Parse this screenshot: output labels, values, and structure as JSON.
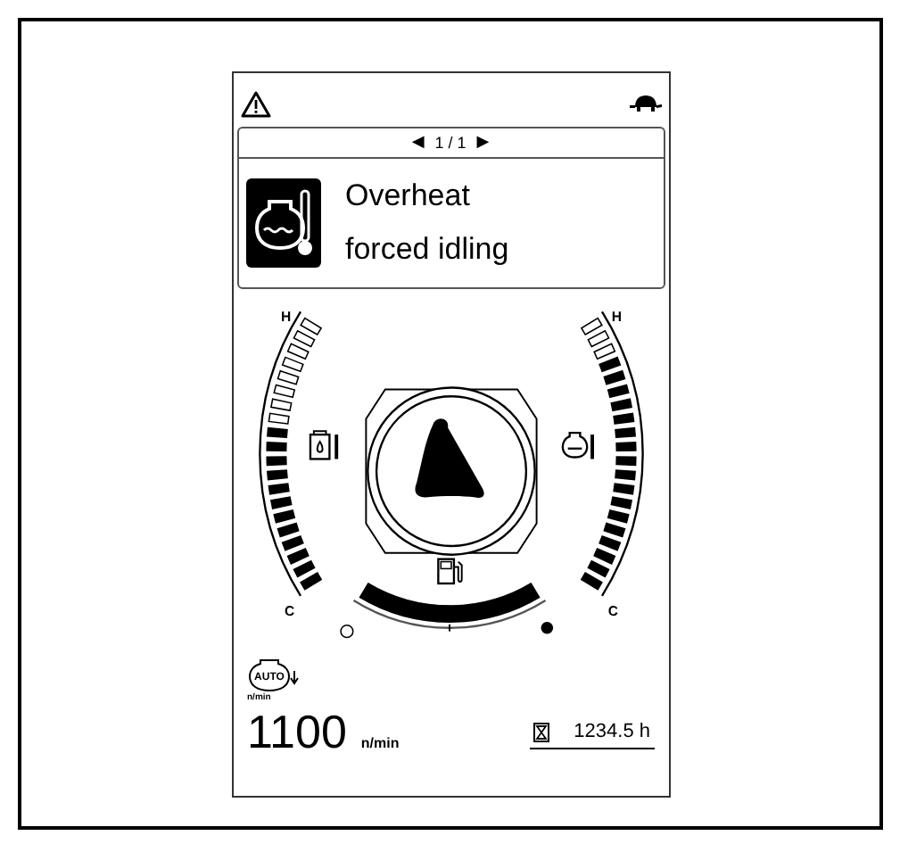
{
  "message": {
    "pager": {
      "prev": "◀",
      "current": "1 / 1",
      "next": "▶"
    },
    "lines": [
      "Overheat",
      "forced idling"
    ]
  },
  "gauges": [
    {
      "kind": "hydraulic_oil_temp",
      "high_label": "H",
      "low_label": "C",
      "level": 0.6
    },
    {
      "kind": "coolant_temp",
      "high_label": "H",
      "low_label": "C",
      "level": 0.85
    }
  ],
  "fuel": {
    "level": 1.0
  },
  "engine": {
    "icon_badge": "AUTO",
    "icon_caption": "n/min",
    "speed": "1100",
    "speed_unit": "n/min"
  },
  "hour_meter": {
    "value": "1234.5 h"
  }
}
